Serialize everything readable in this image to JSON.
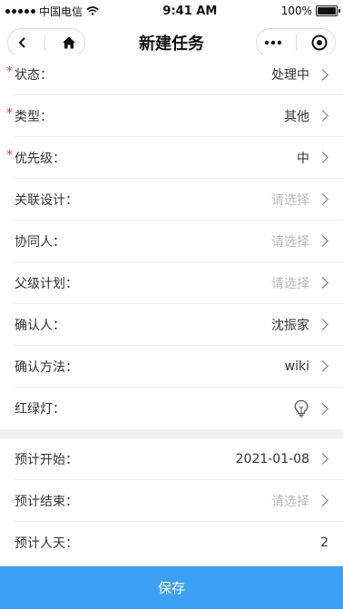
{
  "status_bar": {
    "carrier": "中国电信",
    "time": "9:41 AM",
    "battery": "100%"
  },
  "nav": {
    "title": "新建任务"
  },
  "form_section1": [
    {
      "label": "状态：",
      "value": "处理中",
      "required": true,
      "placeholder": false
    },
    {
      "label": "类型：",
      "value": "其他",
      "required": true,
      "placeholder": false
    },
    {
      "label": "优先级：",
      "value": "中",
      "required": true,
      "placeholder": false
    },
    {
      "label": "关联设计：",
      "value": "请选择",
      "required": false,
      "placeholder": true
    },
    {
      "label": "协同人：",
      "value": "请选择",
      "required": false,
      "placeholder": true
    },
    {
      "label": "父级计划：",
      "value": "请选择",
      "required": false,
      "placeholder": true
    },
    {
      "label": "确认人：",
      "value": "沈振家",
      "required": false,
      "placeholder": false
    },
    {
      "label": "确认方法：",
      "value": "wiki",
      "required": false,
      "placeholder": false
    },
    {
      "label": "红绿灯：",
      "value": "",
      "icon": "lightbulb-icon",
      "required": false,
      "placeholder": false
    }
  ],
  "form_section2": [
    {
      "label": "预计开始：",
      "value": "2021-01-08",
      "required": false,
      "placeholder": false
    },
    {
      "label": "预计结束：",
      "value": "请选择",
      "required": false,
      "placeholder": true
    },
    {
      "label": "预计人天：",
      "value": "2",
      "required": false,
      "placeholder": false
    }
  ],
  "required_mark": "*",
  "save_label": "保存",
  "colors": {
    "accent": "#3ba0f2",
    "required": "#ee3333",
    "placeholder": "#bbbbbb"
  }
}
